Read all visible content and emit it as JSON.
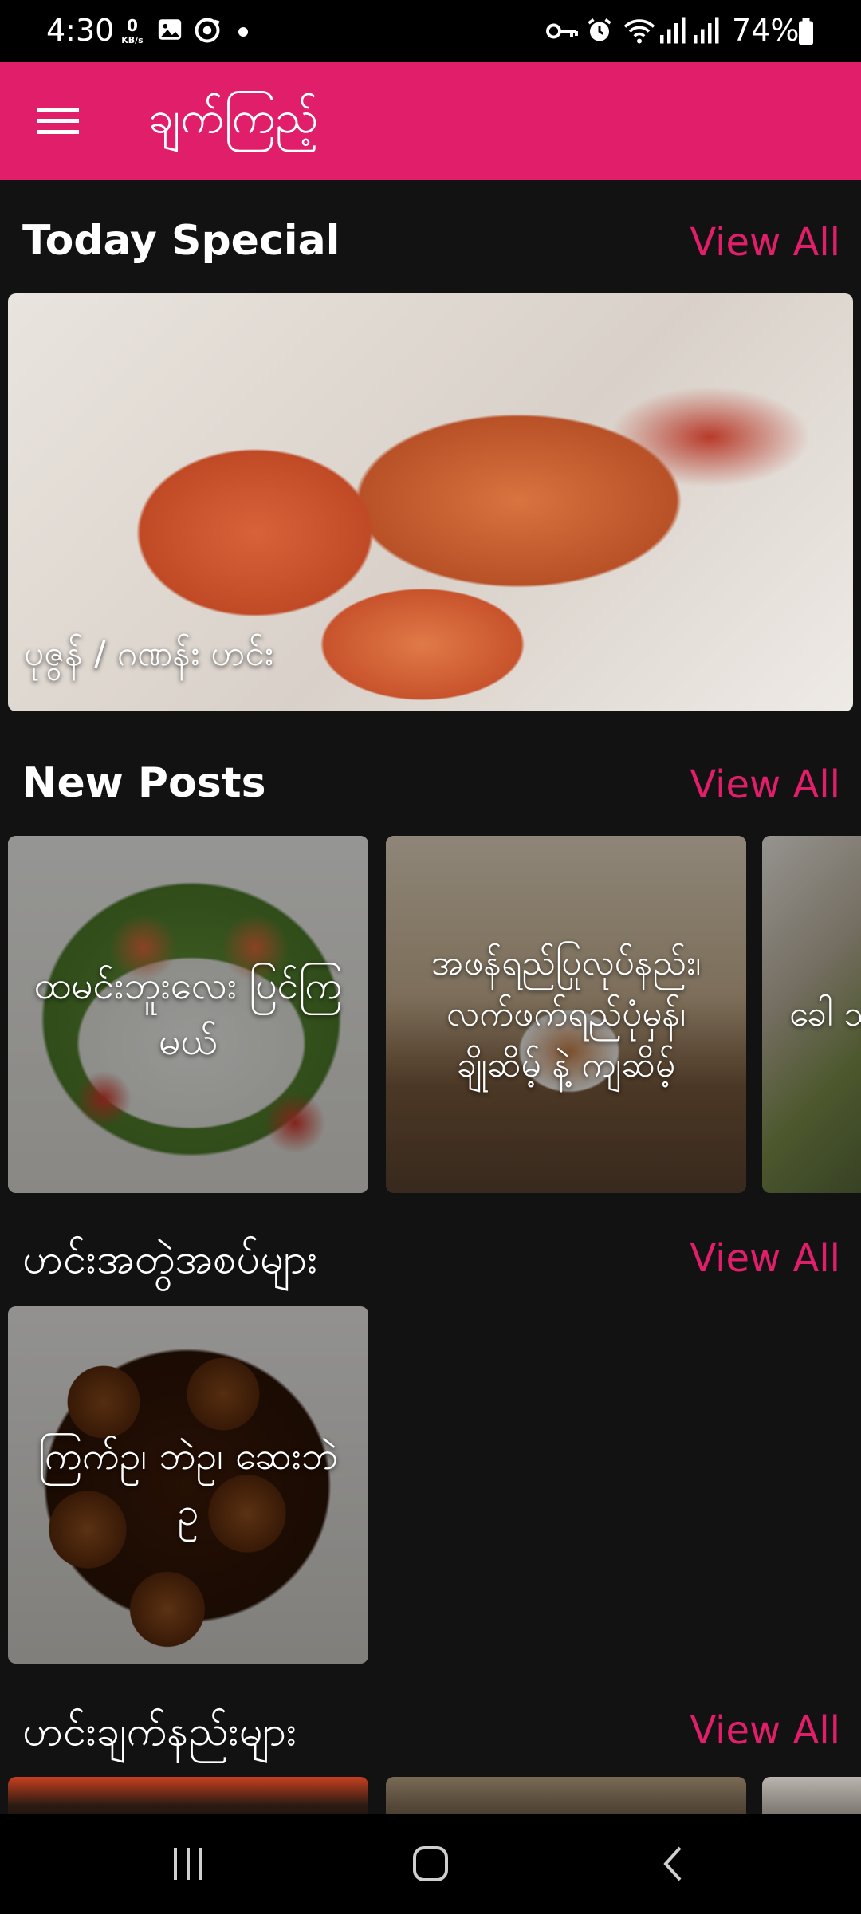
{
  "status_bar": {
    "time": "4:30",
    "net_speed_value": "0",
    "net_speed_unit": "KB/s",
    "battery": "74%",
    "icons": [
      "gallery-icon",
      "sync-icon",
      "dot-icon",
      "vpn-key-icon",
      "alarm-icon",
      "wifi-icon",
      "signal-icon",
      "signal-icon",
      "battery-icon"
    ]
  },
  "app_bar": {
    "title": "ချက်ကြည့်",
    "menu_icon": "hamburger-menu-icon",
    "color": "#e01e6a"
  },
  "sections": {
    "today_special": {
      "title": "Today Special",
      "view_all": "View All",
      "item": {
        "caption": "ပုဇွန် / ဂဏန်း ဟင်း"
      }
    },
    "new_posts": {
      "title": "New Posts",
      "view_all": "View All",
      "items": [
        {
          "title": "ထမင်းဘူးလေး ပြင်ကြမယ်"
        },
        {
          "title": "အဖန်ရည်ပြုလုပ်နည်း၊ လက်ဖက်ရည်ပုံမှန်၊ ချိုဆိမ့် နဲ့ ကျဆိမ့်"
        },
        {
          "title": "ခေါ သူတ ခေါ save"
        }
      ]
    },
    "curry_sets": {
      "title": "ဟင်းအတွဲအစပ်များ",
      "view_all": "View All",
      "items": [
        {
          "title": "ကြက်ဥ၊ ဘဲဥ၊ ဆေးဘဲဥ"
        }
      ]
    },
    "recipes": {
      "title": "ဟင်းချက်နည်းများ",
      "view_all": "View All"
    }
  },
  "nav_bar": {
    "recents": "recents-icon",
    "home": "home-icon",
    "back": "back-icon"
  }
}
